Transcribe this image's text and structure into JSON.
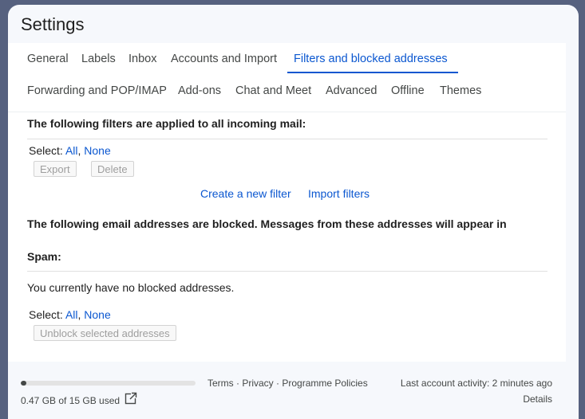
{
  "page": {
    "title": "Settings"
  },
  "tabs": [
    {
      "label": "General",
      "active": false
    },
    {
      "label": "Labels",
      "active": false
    },
    {
      "label": "Inbox",
      "active": false
    },
    {
      "label": "Accounts and Import",
      "active": false
    },
    {
      "label": "Filters and blocked addresses",
      "active": true
    },
    {
      "label": "Forwarding and POP/IMAP",
      "active": false
    },
    {
      "label": "Add-ons",
      "active": false
    },
    {
      "label": "Chat and Meet",
      "active": false
    },
    {
      "label": "Advanced",
      "active": false
    },
    {
      "label": "Offline",
      "active": false
    },
    {
      "label": "Themes",
      "active": false
    }
  ],
  "filters": {
    "heading": "The following filters are applied to all incoming mail:",
    "select_label": "Select:",
    "select_all": "All",
    "separator": ",",
    "select_none": "None",
    "export_button": "Export",
    "delete_button": "Delete",
    "create_link": "Create a new filter",
    "import_link": "Import filters"
  },
  "blocked": {
    "heading_line1": "The following email addresses are blocked. Messages from these addresses will appear in",
    "heading_line2": "Spam:",
    "empty_text": "You currently have no blocked addresses.",
    "select_label": "Select:",
    "select_all": "All",
    "separator": ",",
    "select_none": "None",
    "unblock_button": "Unblock selected addresses"
  },
  "footer": {
    "storage_text": "0.47 GB of 15 GB used",
    "storage_fraction": 0.031,
    "terms": "Terms",
    "privacy": "Privacy",
    "policies": "Programme Policies",
    "link_separator": " · ",
    "activity": "Last account activity: 2 minutes ago",
    "details": "Details"
  },
  "icons": {
    "storage_manage": "external-link-icon"
  },
  "colors": {
    "accent": "#0b57d0",
    "background": "#56617f",
    "panel": "#f6f8fc"
  }
}
